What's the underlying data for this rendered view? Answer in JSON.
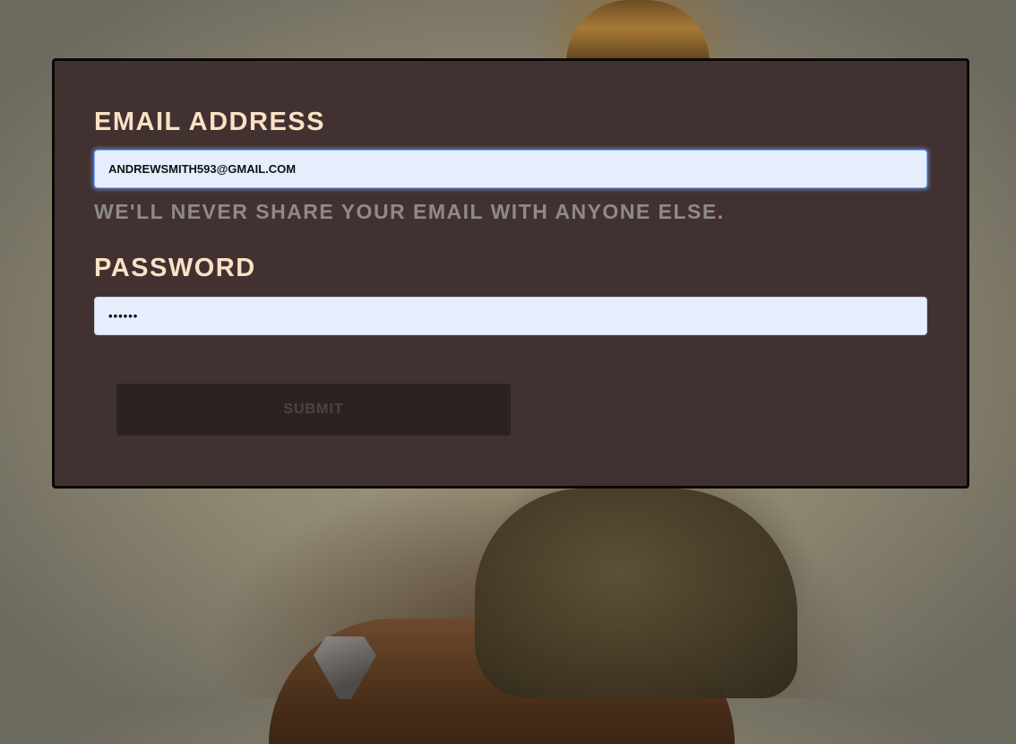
{
  "form": {
    "email": {
      "label": "Email address",
      "value": "andrewsmith593@gmail.com",
      "help_text": "We'll never share your email with anyone else."
    },
    "password": {
      "label": "Password",
      "value": "••••••"
    },
    "submit_label": "Submit"
  },
  "colors": {
    "panel_background": "#413131",
    "label_color": "#fbe1c5",
    "input_background": "#e6eefe",
    "help_text_color": "#8e8a8b",
    "submit_background": "#2c2222",
    "submit_text": "#4c4343"
  }
}
